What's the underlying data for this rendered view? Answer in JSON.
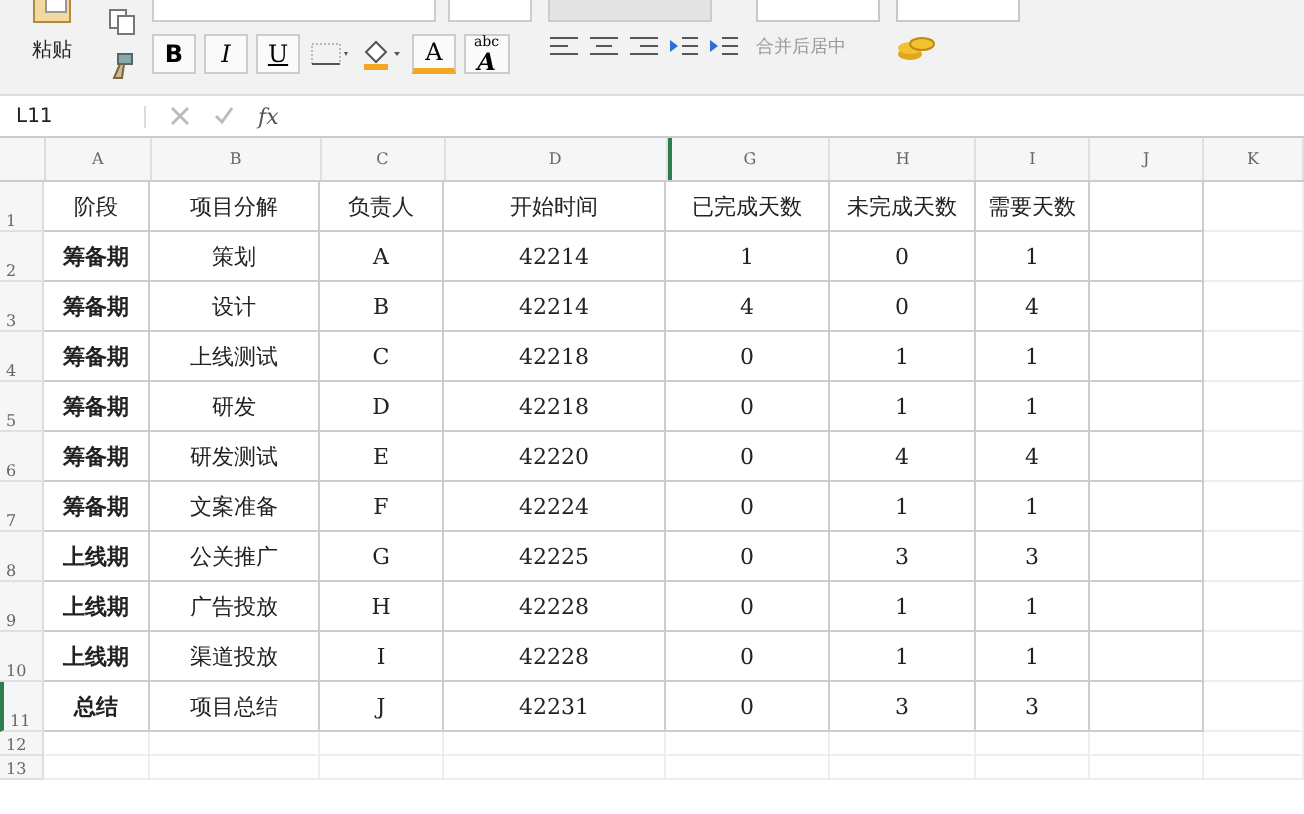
{
  "ribbon": {
    "paste_label": "粘贴",
    "bold": "B",
    "italic": "I",
    "underline": "U",
    "font_color": "A",
    "text_effect_small": "abc",
    "text_effect_big": "A",
    "merge_label": "合并后居中"
  },
  "formula_bar": {
    "name_box": "L11",
    "fx": "fx"
  },
  "columns": [
    "A",
    "B",
    "C",
    "D",
    "G",
    "H",
    "I",
    "J",
    "K"
  ],
  "rows": [
    {
      "number": "1",
      "kind": "header",
      "selected": false,
      "cells": [
        "阶段",
        "项目分解",
        "负责人",
        "开始时间",
        "已完成天数",
        "未完成天数",
        "需要天数"
      ]
    },
    {
      "number": "2",
      "kind": "data",
      "selected": false,
      "cells": [
        "筹备期",
        "策划",
        "A",
        "42214",
        "1",
        "0",
        "1"
      ]
    },
    {
      "number": "3",
      "kind": "data",
      "selected": false,
      "cells": [
        "筹备期",
        "设计",
        "B",
        "42214",
        "4",
        "0",
        "4"
      ]
    },
    {
      "number": "4",
      "kind": "data",
      "selected": false,
      "cells": [
        "筹备期",
        "上线测试",
        "C",
        "42218",
        "0",
        "1",
        "1"
      ]
    },
    {
      "number": "5",
      "kind": "data",
      "selected": false,
      "cells": [
        "筹备期",
        "研发",
        "D",
        "42218",
        "0",
        "1",
        "1"
      ]
    },
    {
      "number": "6",
      "kind": "data",
      "selected": false,
      "cells": [
        "筹备期",
        "研发测试",
        "E",
        "42220",
        "0",
        "4",
        "4"
      ]
    },
    {
      "number": "7",
      "kind": "data",
      "selected": false,
      "cells": [
        "筹备期",
        "文案准备",
        "F",
        "42224",
        "0",
        "1",
        "1"
      ]
    },
    {
      "number": "8",
      "kind": "data",
      "selected": false,
      "cells": [
        "上线期",
        "公关推广",
        "G",
        "42225",
        "0",
        "3",
        "3"
      ]
    },
    {
      "number": "9",
      "kind": "data",
      "selected": false,
      "cells": [
        "上线期",
        "广告投放",
        "H",
        "42228",
        "0",
        "1",
        "1"
      ]
    },
    {
      "number": "10",
      "kind": "data",
      "selected": false,
      "cells": [
        "上线期",
        "渠道投放",
        "I",
        "42228",
        "0",
        "1",
        "1"
      ]
    },
    {
      "number": "11",
      "kind": "data",
      "selected": true,
      "cells": [
        "总结",
        "项目总结",
        "J",
        "42231",
        "0",
        "3",
        "3"
      ]
    },
    {
      "number": "12",
      "kind": "empty",
      "selected": false,
      "cells": []
    },
    {
      "number": "13",
      "kind": "empty",
      "selected": false,
      "cells": []
    }
  ]
}
